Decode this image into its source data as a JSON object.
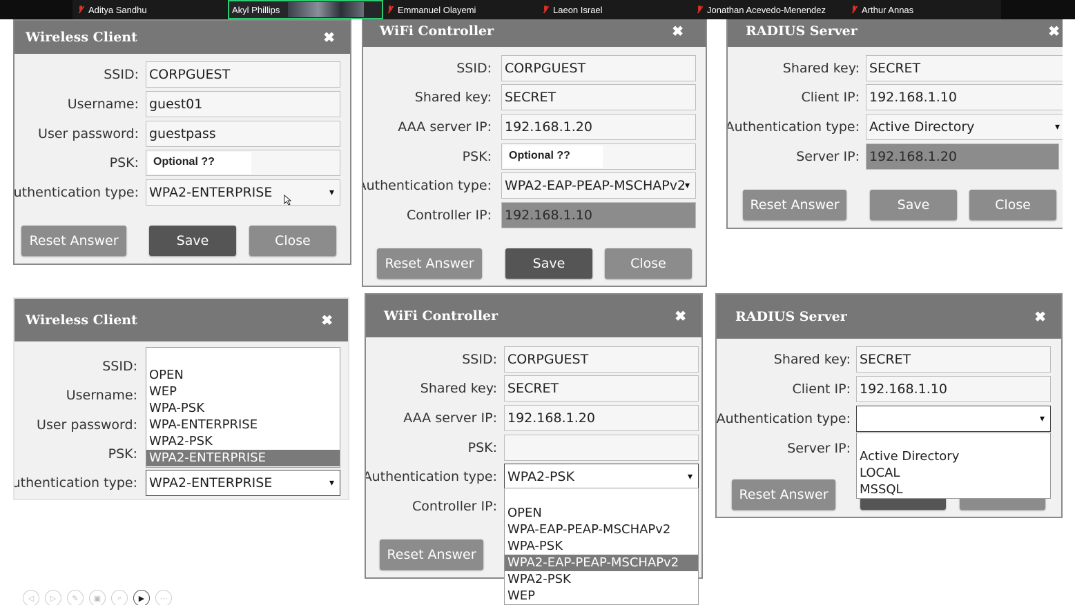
{
  "participants": [
    {
      "name": "Aditya Sandhu",
      "muted": true,
      "active": false
    },
    {
      "name": "Akyl Phillips",
      "muted": false,
      "active": true
    },
    {
      "name": "Emmanuel Olayemi",
      "muted": true,
      "active": false
    },
    {
      "name": "Laeon Israel",
      "muted": true,
      "active": false
    },
    {
      "name": "Jonathan Acevedo-Menendez",
      "muted": true,
      "active": false
    },
    {
      "name": "Arthur Annas",
      "muted": true,
      "active": false
    }
  ],
  "colors": {
    "header": "#777777",
    "active_speaker": "#2ecc71",
    "muted_mic": "#d93025",
    "highlight": "#7a7a7a"
  },
  "close_symbol": "✖",
  "wc1": {
    "title": "Wireless Client",
    "ssid_label": "SSID:",
    "ssid": "CORPGUEST",
    "username_label": "Username:",
    "username": "guest01",
    "password_label": "User password:",
    "password": "guestpass",
    "psk_label": "PSK:",
    "psk": "Optional ??",
    "auth_label": "Authentication type:",
    "auth": "WPA2-ENTERPRISE",
    "reset": "Reset Answer",
    "save": "Save",
    "close": "Close"
  },
  "wifi1": {
    "title": "WiFi Controller",
    "ssid_label": "SSID:",
    "ssid": "CORPGUEST",
    "key_label": "Shared key:",
    "key": "SECRET",
    "aaa_label": "AAA server IP:",
    "aaa": "192.168.1.20",
    "psk_label": "PSK:",
    "psk": "Optional ??",
    "auth_label": "Authentication type:",
    "auth": "WPA2-EAP-PEAP-MSCHAPv2",
    "ctrl_label": "Controller IP:",
    "ctrl": "192.168.1.10",
    "reset": "Reset Answer",
    "save": "Save",
    "close": "Close"
  },
  "radius1": {
    "title": "RADIUS Server",
    "key_label": "Shared key:",
    "key": "SECRET",
    "client_label": "Client IP:",
    "client": "192.168.1.10",
    "auth_label": "Authentication type:",
    "auth": "Active Directory",
    "server_label": "Server IP:",
    "server": "192.168.1.20",
    "reset": "Reset Answer",
    "save": "Save",
    "close": "Close"
  },
  "wc2": {
    "title": "Wireless Client",
    "ssid_label": "SSID:",
    "username_label": "Username:",
    "password_label": "User password:",
    "psk_label": "PSK:",
    "auth_label": "Authentication type:",
    "auth": "WPA2-ENTERPRISE",
    "options": [
      "OPEN",
      "WEP",
      "WPA-PSK",
      "WPA-ENTERPRISE",
      "WPA2-PSK",
      "WPA2-ENTERPRISE"
    ],
    "highlighted": "WPA2-ENTERPRISE"
  },
  "wifi2": {
    "title": "WiFi Controller",
    "ssid_label": "SSID:",
    "ssid": "CORPGUEST",
    "key_label": "Shared key:",
    "key": "SECRET",
    "aaa_label": "AAA server IP:",
    "aaa": "192.168.1.20",
    "psk_label": "PSK:",
    "psk": "",
    "auth_label": "Authentication type:",
    "auth": "WPA2-PSK",
    "ctrl_label": "Controller IP:",
    "options": [
      "OPEN",
      "WPA-EAP-PEAP-MSCHAPv2",
      "WPA-PSK",
      "WPA2-EAP-PEAP-MSCHAPv2",
      "WPA2-PSK",
      "WEP"
    ],
    "highlighted": "WPA2-EAP-PEAP-MSCHAPv2",
    "reset": "Reset Answer"
  },
  "radius2": {
    "title": "RADIUS Server",
    "key_label": "Shared key:",
    "key": "SECRET",
    "client_label": "Client IP:",
    "client": "192.168.1.10",
    "auth_label": "Authentication type:",
    "auth": "",
    "server_label": "Server IP:",
    "options": [
      "Active Directory",
      "LOCAL",
      "MSSQL"
    ],
    "reset": "Reset Answer"
  },
  "toolbar_icons": [
    "prev-icon",
    "next-icon",
    "pen-icon",
    "copy-icon",
    "zoom-icon",
    "camera-icon",
    "more-icon"
  ]
}
